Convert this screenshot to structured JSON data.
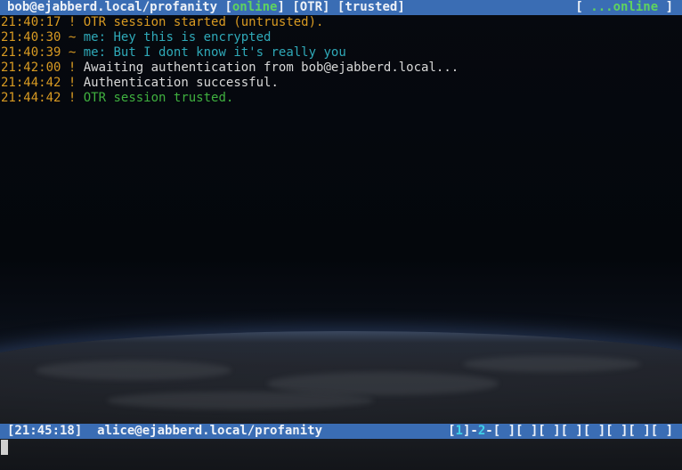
{
  "title_bar": {
    "account": "bob@ejabberd.local/profanity",
    "presence_status": "online",
    "otr_tag": "[OTR]",
    "trust_tag": "[trusted]",
    "right_prefix": "[ ",
    "right_status": "...online",
    "right_suffix": " ]"
  },
  "messages": [
    {
      "time": "21:40:17",
      "marker": "!",
      "text": "OTR session started (untrusted).",
      "color": "#d89a22"
    },
    {
      "time": "21:40:30",
      "marker": "~",
      "text": "me: Hey this is encrypted",
      "color": "#2fa9b8"
    },
    {
      "time": "21:40:39",
      "marker": "~",
      "text": "me: But I dont know it's really you",
      "color": "#2fa9b8"
    },
    {
      "time": "21:42:00",
      "marker": "!",
      "text": "Awaiting authentication from bob@ejabberd.local...",
      "color": "#d8d8d8"
    },
    {
      "time": "21:44:42",
      "marker": "!",
      "text": "Authentication successful.",
      "color": "#d8d8d8"
    },
    {
      "time": "21:44:42",
      "marker": "!",
      "text": "OTR session trusted.",
      "color": "#3fb03f"
    }
  ],
  "status_bar": {
    "clock": "[21:45:18]",
    "jid": "alice@ejabberd.local/profanity",
    "win_open": "[",
    "win_active": "1",
    "win_sep": "]-",
    "win_second": "2",
    "win_rest": "-[ ][ ][ ][ ][ ][ ][ ][ ]"
  },
  "colors": {
    "bar_background": "#3a6db4",
    "timestamp": "#d89a22",
    "online": "#5fd35f",
    "active_window": "#3fd2e8"
  }
}
